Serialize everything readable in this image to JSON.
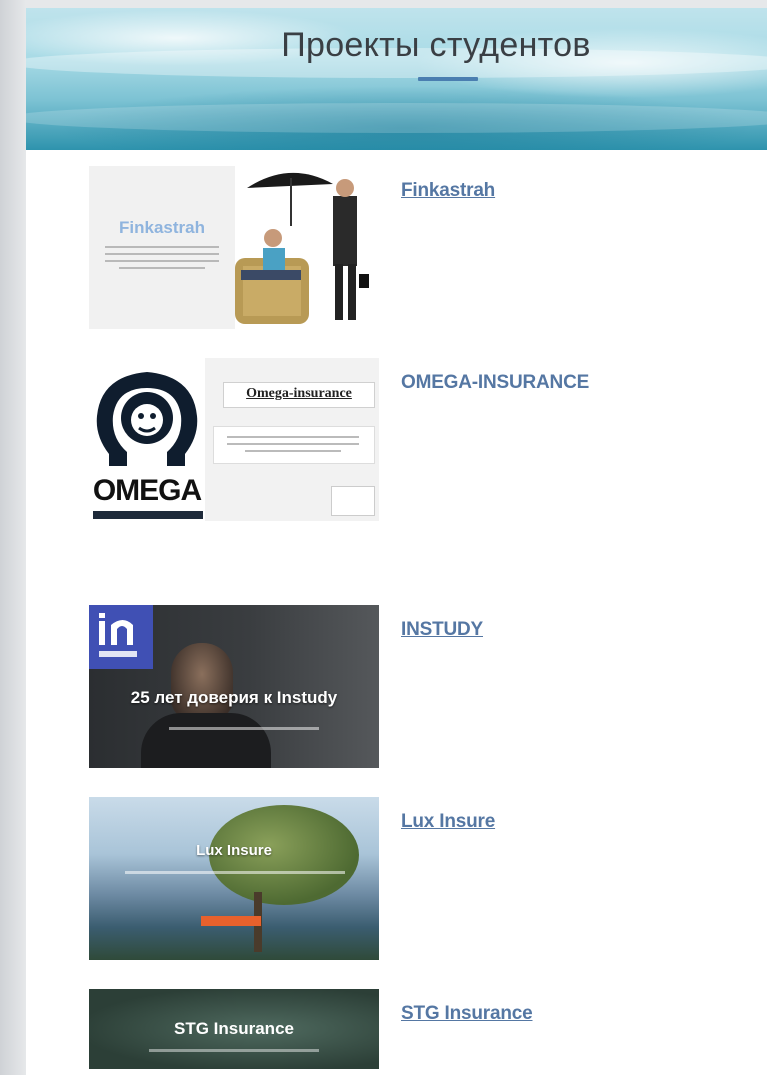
{
  "header": {
    "title": "Проекты студентов"
  },
  "projects": [
    {
      "name": "Finkastrah",
      "thumb_text": "Finkastrah",
      "linked": true
    },
    {
      "name": "OMEGA-INSURANCE",
      "thumb_text": "Omega-insurance",
      "thumb_logo": "OMEGA",
      "linked": false
    },
    {
      "name": "INSTUDY",
      "thumb_text": "25 лет доверия к Instudy",
      "linked": true
    },
    {
      "name": "Lux Insure",
      "thumb_text": "Lux Insure",
      "linked": true
    },
    {
      "name": "STG Insurance",
      "thumb_text": "STG Insurance",
      "linked": true
    }
  ],
  "colors": {
    "link": "#5577a3",
    "underline_accent": "#4a7eb0",
    "title": "#3a3f44"
  }
}
